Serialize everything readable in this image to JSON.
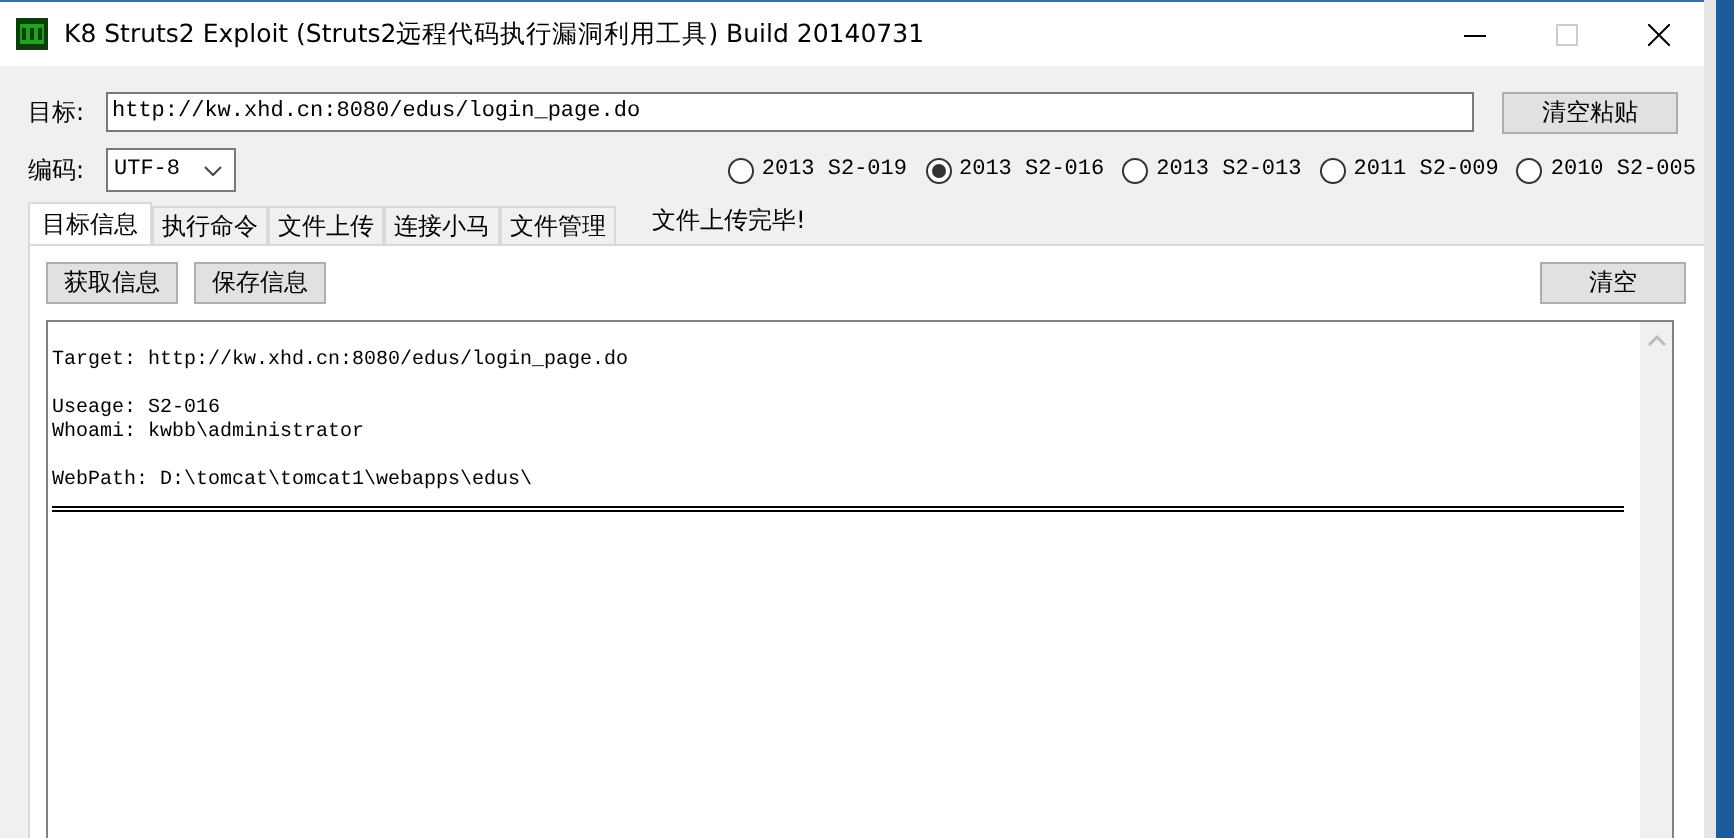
{
  "window": {
    "title": "K8 Struts2 Exploit (Struts2远程代码执行漏洞利用工具)  Build 20140731"
  },
  "target": {
    "label": "目标:",
    "value": "http://kw.xhd.cn:8080/edus/login_page.do",
    "button": "清空粘贴"
  },
  "encoding": {
    "label": "编码:",
    "value": "UTF-8"
  },
  "versions": [
    {
      "label": "2013 S2-019",
      "selected": false
    },
    {
      "label": "2013 S2-016",
      "selected": true
    },
    {
      "label": "2013 S2-013",
      "selected": false
    },
    {
      "label": "2011 S2-009",
      "selected": false
    },
    {
      "label": "2010 S2-005",
      "selected": false
    }
  ],
  "tabs": [
    {
      "label": "目标信息",
      "selected": true
    },
    {
      "label": "执行命令",
      "selected": false
    },
    {
      "label": "文件上传",
      "selected": false
    },
    {
      "label": "连接小马",
      "selected": false
    },
    {
      "label": "文件管理",
      "selected": false
    }
  ],
  "status": "文件上传完毕!",
  "buttons": [
    "获取信息",
    "保存信息"
  ],
  "clear_button": "清空",
  "output": {
    "blocks": [
      [
        "Target: http://kw.xhd.cn:8080/edus/login_page.do"
      ],
      [
        "Useage: S2-016",
        "Whoami: kwbb\\administrator"
      ],
      [
        "WebPath: D:\\tomcat\\tomcat1\\webapps\\edus\\"
      ]
    ]
  }
}
